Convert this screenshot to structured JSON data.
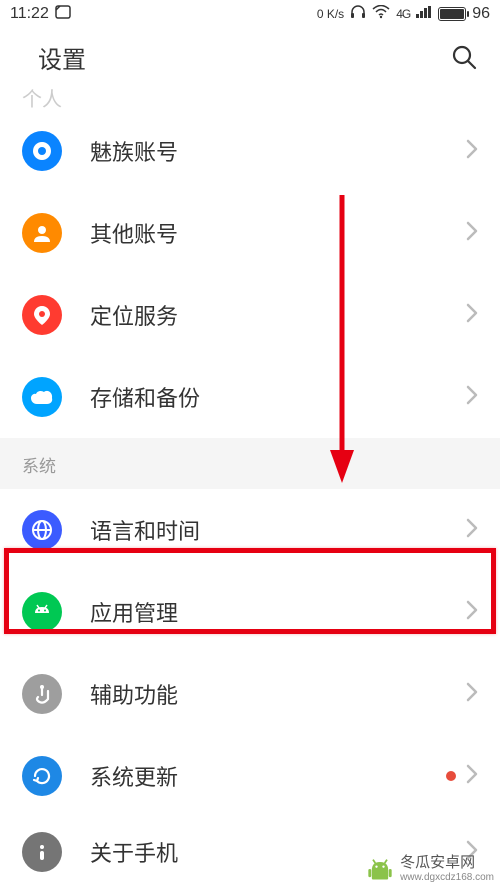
{
  "status": {
    "time": "11:22",
    "net_speed": "0 K/s",
    "network": "4G",
    "battery": "96"
  },
  "header": {
    "title": "设置"
  },
  "sections": {
    "personal_partial": "个人",
    "system": "系统"
  },
  "items": {
    "meizu_account": "魅族账号",
    "other_account": "其他账号",
    "location": "定位服务",
    "storage": "存储和备份",
    "language": "语言和时间",
    "apps": "应用管理",
    "accessibility": "辅助功能",
    "update": "系统更新",
    "about": "关于手机"
  },
  "watermark": {
    "main": "冬瓜安卓网",
    "sub": "www.dgxcdz168.com"
  },
  "colors": {
    "highlight": "#e60012",
    "arrow": "#e60012"
  }
}
